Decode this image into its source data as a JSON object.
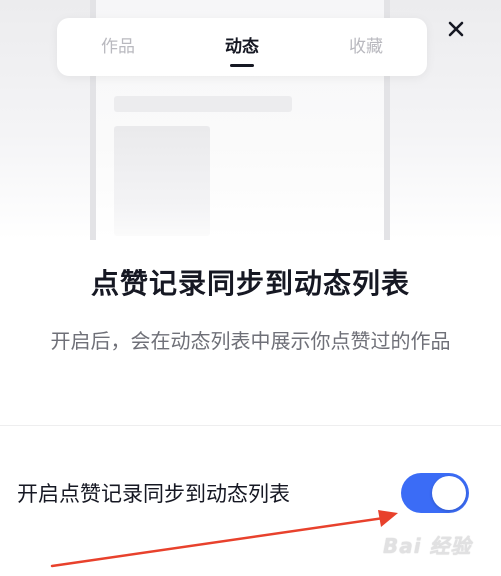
{
  "tabs": {
    "works": "作品",
    "moments": "动态",
    "favorites": "收藏",
    "active": "moments"
  },
  "close_icon": "close-icon",
  "dialog": {
    "title": "点赞记录同步到动态列表",
    "description": "开启后，会在动态列表中展示你点赞过的作品"
  },
  "setting": {
    "label": "开启点赞记录同步到动态列表",
    "enabled": true,
    "toggle_color": "#3b6cf6"
  },
  "annotation": {
    "arrow_color": "#e8412c"
  },
  "watermark": {
    "text": "Bai 经验"
  }
}
